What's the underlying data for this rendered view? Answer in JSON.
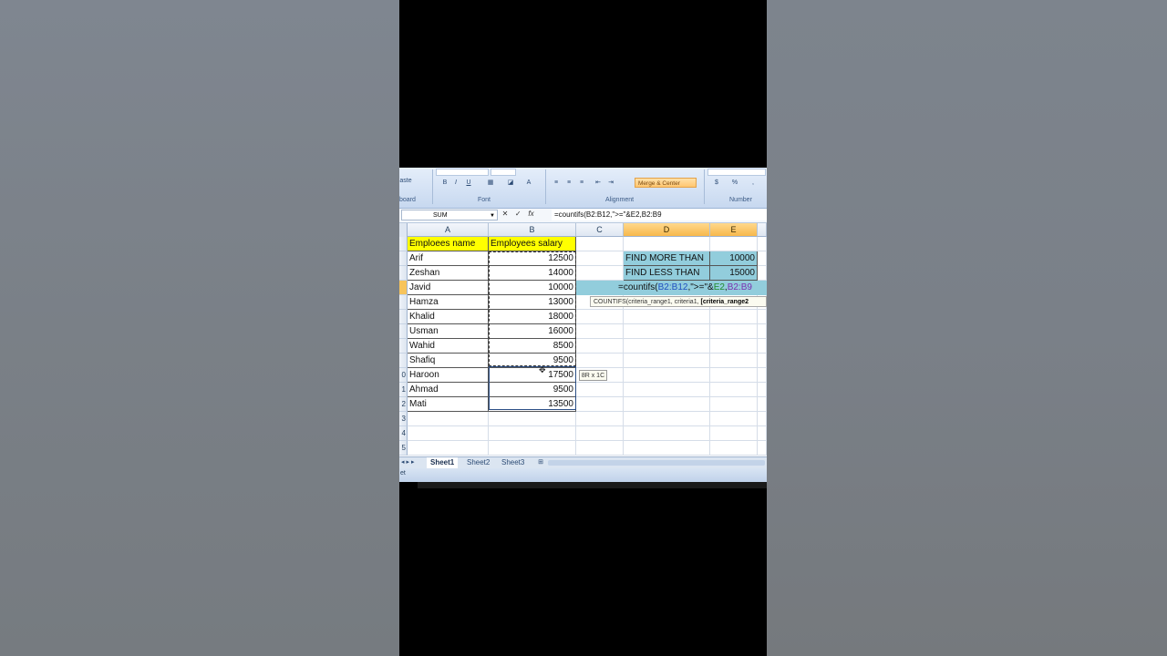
{
  "ribbon": {
    "paste_label": "aste",
    "clipboard_label": "board",
    "font_label": "Font",
    "alignment_label": "Alignment",
    "number_label": "Number",
    "merge_label": "Merge & Center",
    "bold": "B",
    "italic": "I",
    "underline": "U",
    "currency": "$",
    "percent": "%"
  },
  "formula_bar": {
    "name_box": "SUM",
    "cancel": "✕",
    "enter": "✓",
    "fx": "fx",
    "formula": "=countifs(B2:B12,\">=\"&E2,B2:B9"
  },
  "columns": [
    "A",
    "B",
    "C",
    "D",
    "E"
  ],
  "rows": [
    "",
    "",
    "",
    "",
    "",
    "",
    "",
    "",
    "",
    "0",
    "1",
    "2",
    "3",
    "4",
    "5"
  ],
  "table": {
    "header_name": "Emploees name",
    "header_salary": "Employees salary",
    "records": [
      {
        "name": "Arif",
        "salary": "12500"
      },
      {
        "name": "Zeshan",
        "salary": "14000"
      },
      {
        "name": "Javid",
        "salary": "10000"
      },
      {
        "name": "Hamza",
        "salary": "13000"
      },
      {
        "name": "Khalid",
        "salary": "18000"
      },
      {
        "name": "Usman",
        "salary": "16000"
      },
      {
        "name": "Wahid",
        "salary": "8500"
      },
      {
        "name": "Shafiq",
        "salary": "9500"
      },
      {
        "name": "Haroon",
        "salary": "17500"
      },
      {
        "name": "Ahmad",
        "salary": "9500"
      },
      {
        "name": "Mati",
        "salary": "13500"
      }
    ]
  },
  "criteria": {
    "more_label": "FIND MORE THAN",
    "more_value": "10000",
    "less_label": "FIND LESS THAN",
    "less_value": "15000"
  },
  "edit_cell": {
    "prefix": "=countifs(",
    "ref1": "B2:B12",
    "mid": ",\">=\"&",
    "ref2": "E2",
    "comma": ",",
    "ref3": "B2:B9"
  },
  "tooltip": {
    "text": "COUNTIFS(criteria_range1, criteria1, ",
    "bold": "[criteria_range2"
  },
  "size_tip": "8R x 1C",
  "sheets": [
    "Sheet1",
    "Sheet2",
    "Sheet3"
  ],
  "status": "et",
  "colors": {
    "header_yellow": "#ffff00",
    "criteria_teal": "#92cddc",
    "ref_blue": "#1f4fbf",
    "ref_green": "#1f8a2a",
    "ref_purple": "#7a2fb0"
  }
}
